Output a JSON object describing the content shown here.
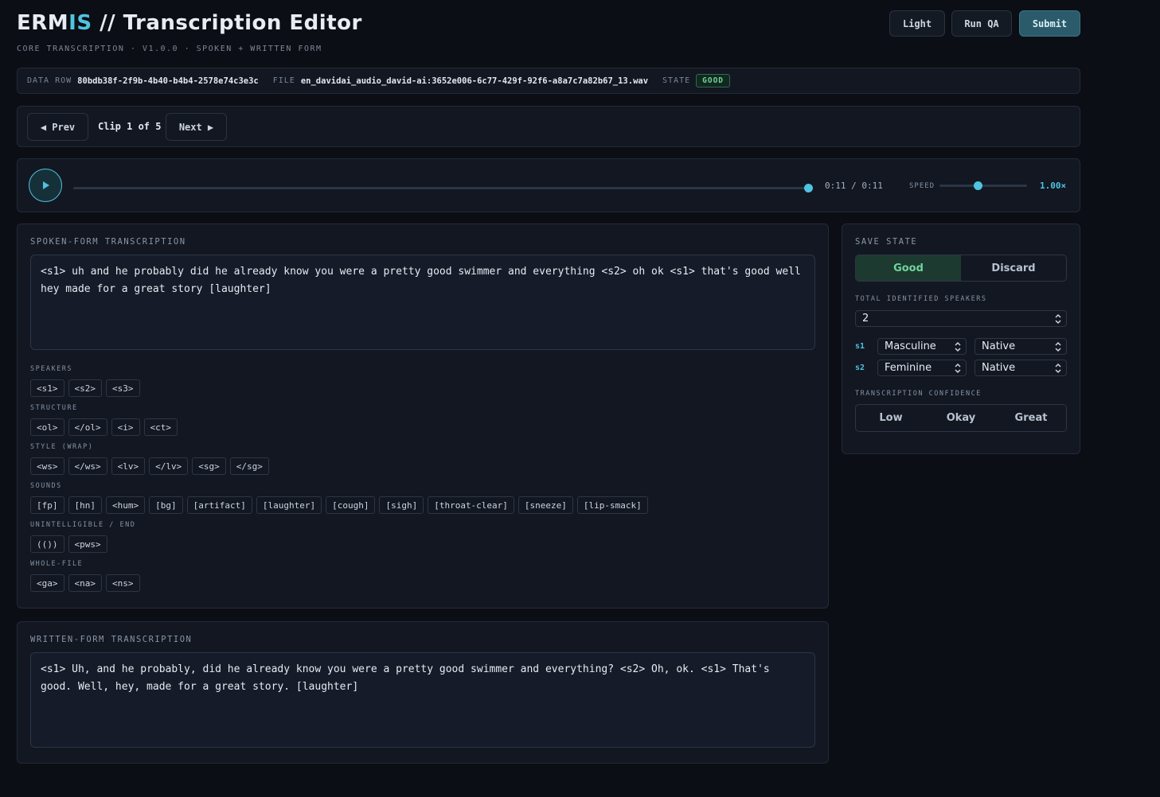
{
  "header": {
    "title_a": "ERM",
    "title_b": "IS",
    "title_c": " // Transcription Editor",
    "subtitle": "CORE TRANSCRIPTION · V1.0.0 · SPOKEN + WRITTEN FORM",
    "light_label": "Light",
    "qa_label": "Run QA",
    "submit_label": "Submit"
  },
  "meta": {
    "row_label": "DATA ROW",
    "row_value": "80bdb38f-2f9b-4b40-b4b4-2578e74c3e3c",
    "file_label": "FILE",
    "file_value": "en_davidai_audio_david-ai:3652e006-6c77-429f-92f6-a8a7c7a82b67_13.wav",
    "state_label": "STATE",
    "state_value": "GOOD"
  },
  "nav": {
    "prev_label": "◀ Prev",
    "clip_label": "Clip 1 of 5",
    "next_label": "Next ▶"
  },
  "player": {
    "time": "0:11 / 0:11",
    "progress": 1.0,
    "speed_label": "SPEED",
    "speed_value": "1.00×"
  },
  "spoken": {
    "title": "SPOKEN-FORM TRANSCRIPTION",
    "text": "<s1> uh and he probably did he already know you were a pretty good swimmer and everything <s2> oh ok <s1> that's good well hey made for a great story [laughter]",
    "groups": [
      {
        "label": "SPEAKERS",
        "tags": [
          "<s1>",
          "<s2>",
          "<s3>"
        ]
      },
      {
        "label": "STRUCTURE",
        "tags": [
          "<ol>",
          "</ol>",
          "<i>",
          "<ct>"
        ]
      },
      {
        "label": "STYLE (WRAP)",
        "tags": [
          "<ws>",
          "</ws>",
          "<lv>",
          "</lv>",
          "<sg>",
          "</sg>"
        ]
      },
      {
        "label": "SOUNDS",
        "tags": [
          "[fp]",
          "[hn]",
          "<hum>",
          "[bg]",
          "[artifact]",
          "[laughter]",
          "[cough]",
          "[sigh]",
          "[throat-clear]",
          "[sneeze]",
          "[lip-smack]"
        ]
      },
      {
        "label": "UNINTELLIGIBLE / END",
        "tags": [
          "(())",
          "<pws>"
        ]
      },
      {
        "label": "WHOLE-FILE",
        "tags": [
          "<ga>",
          "<na>",
          "<ns>"
        ]
      }
    ]
  },
  "written": {
    "title": "WRITTEN-FORM TRANSCRIPTION",
    "text": "<s1> Uh, and he probably, did he already know you were a pretty good swimmer and everything? <s2> Oh, ok. <s1> That's good. Well, hey, made for a great story. [laughter]"
  },
  "side": {
    "save_title": "SAVE STATE",
    "good_label": "Good",
    "discard_label": "Discard",
    "speakers_title": "TOTAL IDENTIFIED SPEAKERS",
    "speakers_value": "2",
    "s1_label": "s1",
    "s1_gender": "Masculine",
    "s1_native": "Native",
    "s2_label": "s2",
    "s2_gender": "Feminine",
    "s2_native": "Native",
    "confidence_title": "TRANSCRIPTION CONFIDENCE",
    "conf_low": "Low",
    "conf_okay": "Okay",
    "conf_great": "Great"
  },
  "colors": {
    "accent": "#4fc3e0",
    "good": "#6fd39c",
    "background": "#0b0e14"
  }
}
